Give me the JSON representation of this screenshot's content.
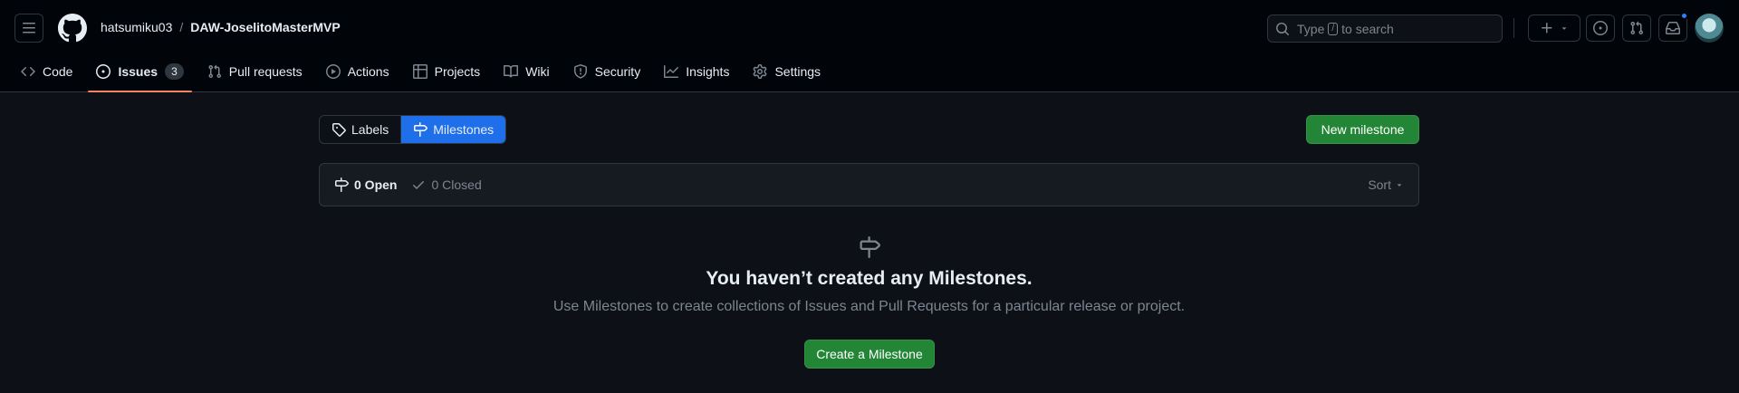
{
  "header": {
    "owner": "hatsumiku03",
    "separator": "/",
    "repo": "DAW-JoselitoMasterMVP",
    "search": {
      "prefix": "Type",
      "key": "/",
      "suffix": "to search"
    }
  },
  "tabs": [
    {
      "label": "Code",
      "icon": "code-icon"
    },
    {
      "label": "Issues",
      "icon": "issue-opened-icon",
      "count": "3"
    },
    {
      "label": "Pull requests",
      "icon": "git-pull-request-icon"
    },
    {
      "label": "Actions",
      "icon": "play-icon"
    },
    {
      "label": "Projects",
      "icon": "table-icon"
    },
    {
      "label": "Wiki",
      "icon": "book-icon"
    },
    {
      "label": "Security",
      "icon": "shield-icon"
    },
    {
      "label": "Insights",
      "icon": "graph-icon"
    },
    {
      "label": "Settings",
      "icon": "gear-icon"
    }
  ],
  "subnav": {
    "labels": "Labels",
    "milestones": "Milestones"
  },
  "new_milestone": "New milestone",
  "filters": {
    "open": "0 Open",
    "closed": "0 Closed",
    "sort": "Sort"
  },
  "blankslate": {
    "title": "You haven’t created any Milestones.",
    "description": "Use Milestones to create collections of Issues and Pull Requests for a particular release or project.",
    "button": "Create a Milestone"
  },
  "colors": {
    "accent": "#1f6feb",
    "green": "#238636",
    "tab_underline": "#f78166",
    "notification": "#2f81f7"
  }
}
